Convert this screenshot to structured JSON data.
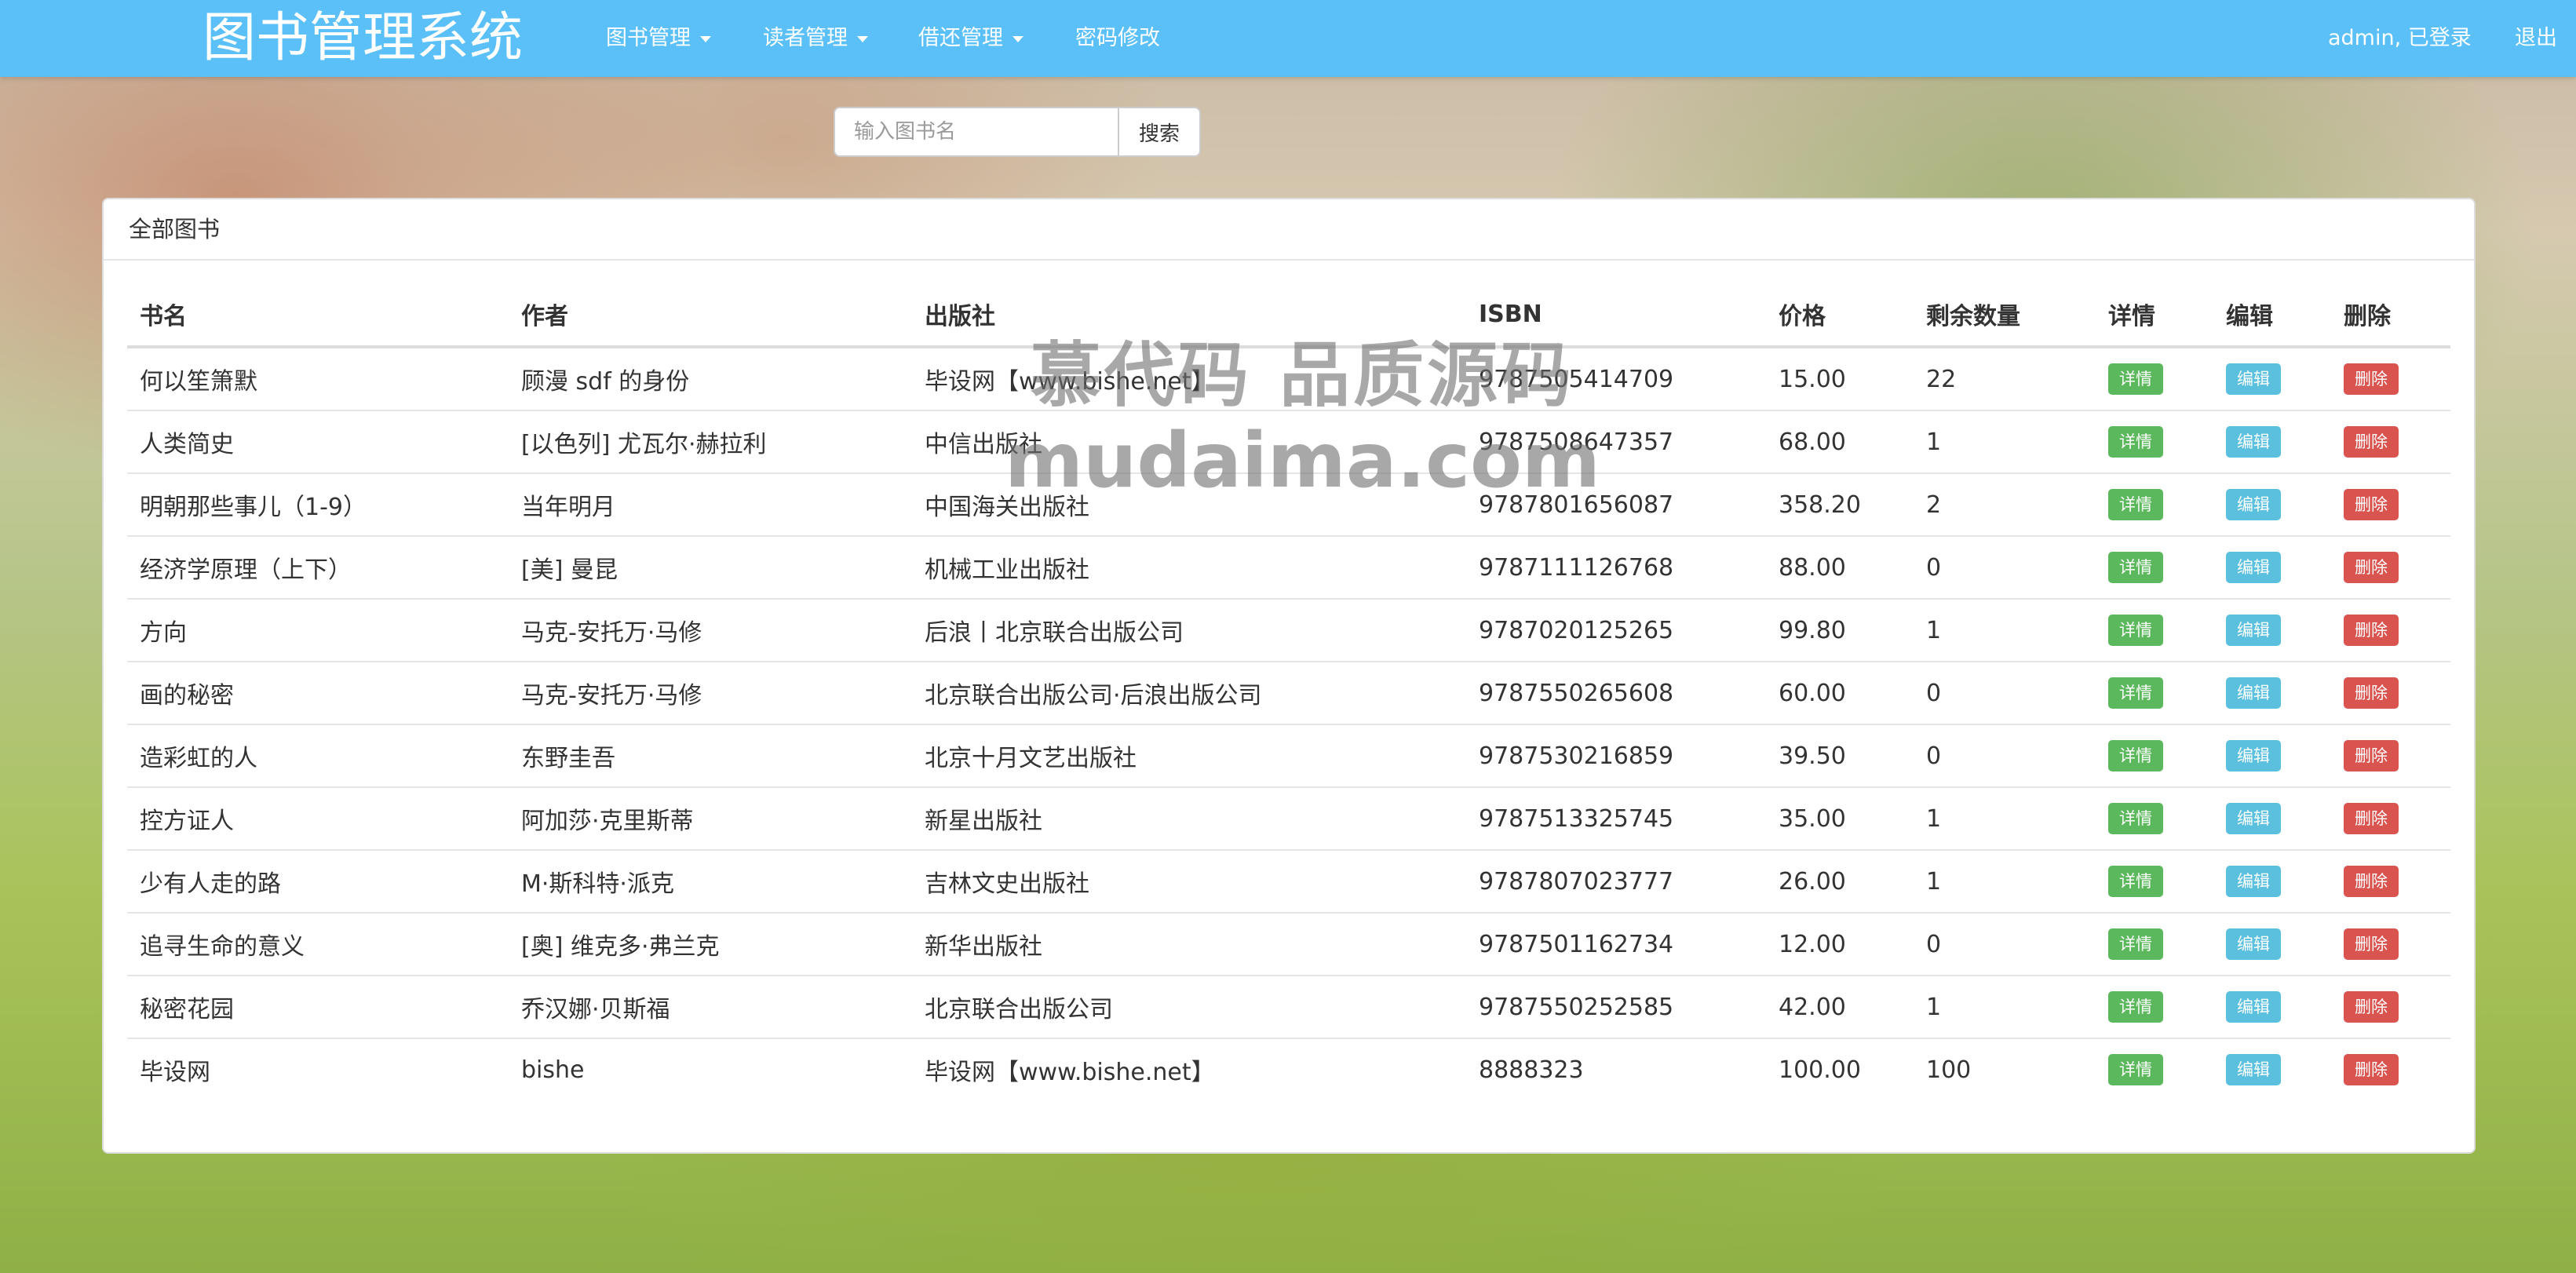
{
  "app": {
    "title": "图书管理系统",
    "nav": [
      {
        "label": "图书管理",
        "dropdown": true
      },
      {
        "label": "读者管理",
        "dropdown": true
      },
      {
        "label": "借还管理",
        "dropdown": true
      },
      {
        "label": "密码修改",
        "dropdown": false
      }
    ],
    "user_status": "admin, 已登录",
    "logout_label": "退出"
  },
  "search": {
    "placeholder": "输入图书名",
    "button_label": "搜索"
  },
  "panel": {
    "heading": "全部图书"
  },
  "table": {
    "columns": [
      "书名",
      "作者",
      "出版社",
      "ISBN",
      "价格",
      "剩余数量",
      "详情",
      "编辑",
      "删除"
    ],
    "action_labels": {
      "detail": "详情",
      "edit": "编辑",
      "delete": "删除"
    },
    "rows": [
      {
        "title": "何以笙箫默",
        "author": "顾漫 sdf 的身份",
        "publisher": "毕设网【www.bishe.net】",
        "isbn": "9787505414709",
        "price": "15.00",
        "stock": "22"
      },
      {
        "title": "人类简史",
        "author": "[以色列] 尤瓦尔·赫拉利",
        "publisher": "中信出版社",
        "isbn": "9787508647357",
        "price": "68.00",
        "stock": "1"
      },
      {
        "title": "明朝那些事儿（1-9）",
        "author": "当年明月",
        "publisher": "中国海关出版社",
        "isbn": "9787801656087",
        "price": "358.20",
        "stock": "2"
      },
      {
        "title": "经济学原理（上下）",
        "author": "[美] 曼昆",
        "publisher": "机械工业出版社",
        "isbn": "9787111126768",
        "price": "88.00",
        "stock": "0"
      },
      {
        "title": "方向",
        "author": "马克-安托万·马修",
        "publisher": "后浪丨北京联合出版公司",
        "isbn": "9787020125265",
        "price": "99.80",
        "stock": "1"
      },
      {
        "title": "画的秘密",
        "author": "马克-安托万·马修",
        "publisher": "北京联合出版公司·后浪出版公司",
        "isbn": "9787550265608",
        "price": "60.00",
        "stock": "0"
      },
      {
        "title": "造彩虹的人",
        "author": "东野圭吾",
        "publisher": "北京十月文艺出版社",
        "isbn": "9787530216859",
        "price": "39.50",
        "stock": "0"
      },
      {
        "title": "控方证人",
        "author": "阿加莎·克里斯蒂",
        "publisher": "新星出版社",
        "isbn": "9787513325745",
        "price": "35.00",
        "stock": "1"
      },
      {
        "title": "少有人走的路",
        "author": "M·斯科特·派克",
        "publisher": "吉林文史出版社",
        "isbn": "9787807023777",
        "price": "26.00",
        "stock": "1"
      },
      {
        "title": "追寻生命的意义",
        "author": "[奥] 维克多·弗兰克",
        "publisher": "新华出版社",
        "isbn": "9787501162734",
        "price": "12.00",
        "stock": "0"
      },
      {
        "title": "秘密花园",
        "author": "乔汉娜·贝斯福",
        "publisher": "北京联合出版公司",
        "isbn": "9787550252585",
        "price": "42.00",
        "stock": "1"
      },
      {
        "title": "毕设网",
        "author": "bishe",
        "publisher": "毕设网【www.bishe.net】",
        "isbn": "8888323",
        "price": "100.00",
        "stock": "100"
      }
    ]
  },
  "watermark": {
    "line1": "慕代码 品质源码",
    "line2": "mudaima.com"
  },
  "colors": {
    "navbar": "#5bc0f8",
    "detail": "#5cb85c",
    "edit": "#5bc0de",
    "delete": "#d9534f"
  }
}
